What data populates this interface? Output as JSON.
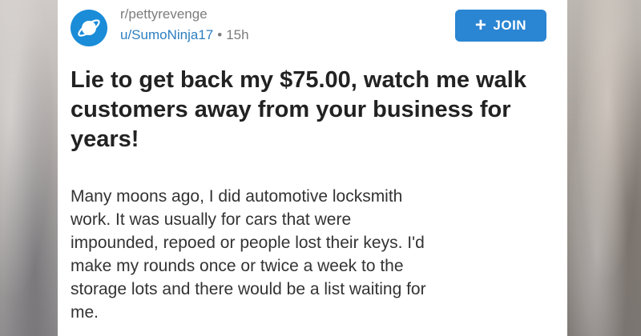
{
  "post": {
    "subreddit": "r/pettyrevenge",
    "author": "u/SumoNinja17",
    "separator": "•",
    "age": "15h",
    "join_label": "JOIN",
    "join_icon": "plus-icon",
    "avatar_icon": "planet-icon",
    "title": "Lie to get back my $75.00, watch me walk customers away from your business for years!",
    "body": "Many moons ago, I did automotive locksmith\nwork.   It was usually for cars that were\nimpounded, repoed or people lost their keys.  I'd\nmake my rounds once or twice a week to the\nstorage lots and there would be a list waiting for\nme."
  },
  "colors": {
    "accent": "#2a85d3",
    "avatar": "#1a8cd8",
    "username": "#2d7fc1",
    "meta": "#7c7c7c",
    "title": "#222222"
  }
}
